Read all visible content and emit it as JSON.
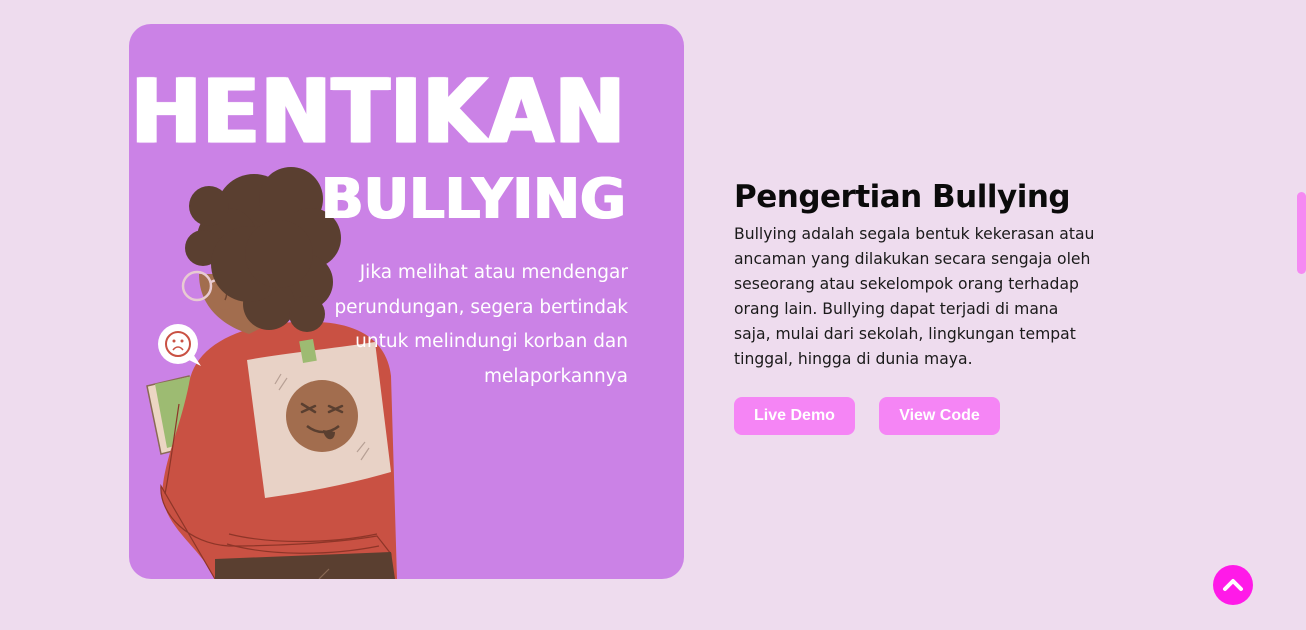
{
  "poster": {
    "title_line1": "HENTIKAN",
    "title_line2": "BULLYING",
    "subtitle": "Jika melihat atau mendengar perundungan, segera bertindak untuk melindungi korban dan melaporkannya",
    "colors": {
      "background": "#cb82e6",
      "sweater": "#c95143",
      "hair": "#5a3f30",
      "sign": "#e8d2c6"
    }
  },
  "section": {
    "title": "Pengertian Bullying",
    "description": "Bullying adalah segala bentuk kekerasan atau ancaman yang dilakukan secara sengaja oleh seseorang atau sekelompok orang terhadap orang lain. Bullying dapat terjadi di mana saja, mulai dari sekolah, lingkungan tempat tinggal, hingga di dunia maya."
  },
  "buttons": {
    "live_demo": "Live Demo",
    "view_code": "View Code"
  },
  "back_to_top": {
    "icon": "chevron-up-icon",
    "color": "#ff1ae8"
  },
  "theme": {
    "page_background": "#eedcee",
    "accent": "#f585f5"
  }
}
